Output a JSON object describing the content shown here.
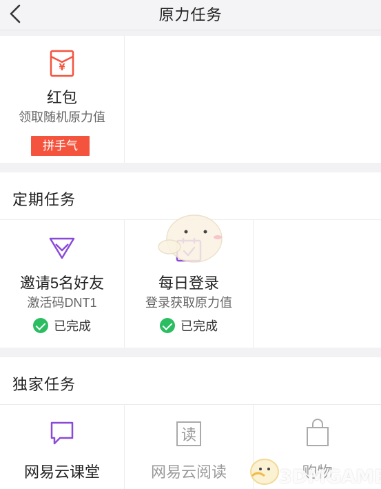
{
  "header": {
    "title": "原力任务"
  },
  "red_envelope": {
    "title": "红包",
    "subtitle": "领取随机原力值",
    "button": "拼手气"
  },
  "periodic": {
    "section_title": "定期任务",
    "cards": [
      {
        "title": "邀请5名好友",
        "subtitle": "激活码DNT1",
        "status": "已完成"
      },
      {
        "title": "每日登录",
        "subtitle": "登录获取原力值",
        "status": "已完成"
      }
    ]
  },
  "exclusive": {
    "section_title": "独家任务",
    "cards": [
      {
        "title": "网易云课堂"
      },
      {
        "title": "网易云阅读"
      },
      {
        "title": "购物"
      }
    ]
  },
  "watermark": {
    "text": "3DMGAME"
  },
  "colors": {
    "accent_red": "#f4543e",
    "purple": "#8a4ad8",
    "success_green": "#2bbd62"
  },
  "icons": [
    "back-icon",
    "red-envelope-icon",
    "diamond-icon",
    "calendar-check-icon",
    "speech-bubble-icon",
    "read-icon",
    "shopping-bag-icon",
    "check-circle-icon"
  ]
}
